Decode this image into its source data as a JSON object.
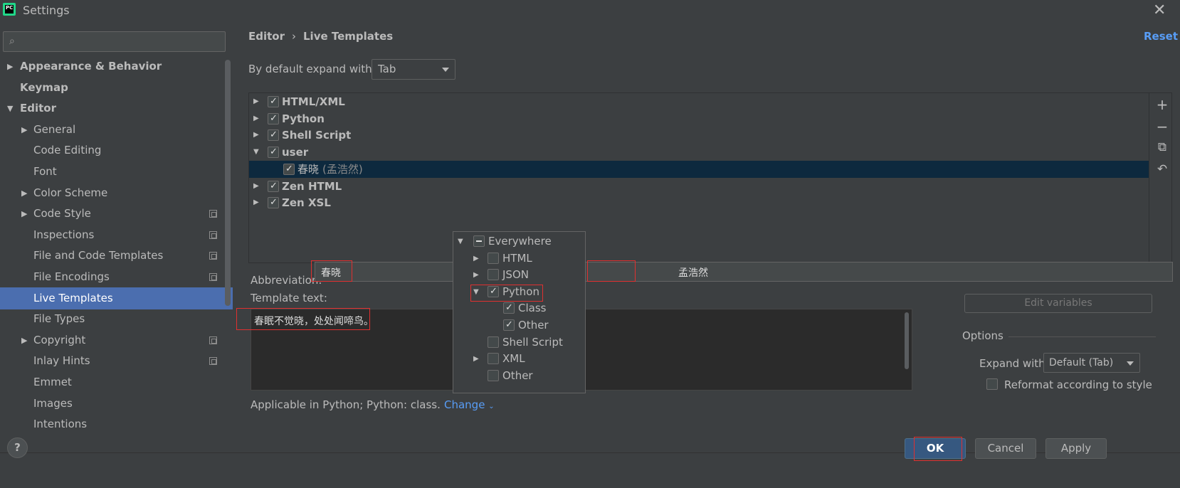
{
  "window": {
    "title": "Settings",
    "logo": "PC"
  },
  "sidebar": {
    "search": {
      "value": "",
      "placeholder": ""
    },
    "items": [
      {
        "label": "Appearance & Behavior",
        "bold": true,
        "arrow": "right",
        "indent": 0
      },
      {
        "label": "Keymap",
        "bold": true,
        "arrow": "",
        "indent": 0
      },
      {
        "label": "Editor",
        "bold": true,
        "arrow": "down",
        "indent": 0
      },
      {
        "label": "General",
        "bold": false,
        "arrow": "right",
        "indent": 1
      },
      {
        "label": "Code Editing",
        "bold": false,
        "arrow": "",
        "indent": 1
      },
      {
        "label": "Font",
        "bold": false,
        "arrow": "",
        "indent": 1
      },
      {
        "label": "Color Scheme",
        "bold": false,
        "arrow": "right",
        "indent": 1
      },
      {
        "label": "Code Style",
        "bold": false,
        "arrow": "right",
        "indent": 1,
        "copy": true
      },
      {
        "label": "Inspections",
        "bold": false,
        "arrow": "",
        "indent": 1,
        "copy": true
      },
      {
        "label": "File and Code Templates",
        "bold": false,
        "arrow": "",
        "indent": 1,
        "copy": true
      },
      {
        "label": "File Encodings",
        "bold": false,
        "arrow": "",
        "indent": 1,
        "copy": true
      },
      {
        "label": "Live Templates",
        "bold": false,
        "arrow": "",
        "indent": 1,
        "selected": true
      },
      {
        "label": "File Types",
        "bold": false,
        "arrow": "",
        "indent": 1
      },
      {
        "label": "Copyright",
        "bold": false,
        "arrow": "right",
        "indent": 1,
        "copy": true
      },
      {
        "label": "Inlay Hints",
        "bold": false,
        "arrow": "",
        "indent": 1,
        "copy": true
      },
      {
        "label": "Emmet",
        "bold": false,
        "arrow": "",
        "indent": 1
      },
      {
        "label": "Images",
        "bold": false,
        "arrow": "",
        "indent": 1
      },
      {
        "label": "Intentions",
        "bold": false,
        "arrow": "",
        "indent": 1
      }
    ]
  },
  "header": {
    "breadcrumb": [
      "Editor",
      "Live Templates"
    ],
    "reset": "Reset"
  },
  "expand": {
    "label": "By default expand with",
    "value": "Tab"
  },
  "tree": {
    "rows": [
      {
        "label": "HTML/XML",
        "checked": true,
        "arrow": "right",
        "level": 0
      },
      {
        "label": "Python",
        "checked": true,
        "arrow": "right",
        "level": 0
      },
      {
        "label": "Shell Script",
        "checked": true,
        "arrow": "right",
        "level": 0
      },
      {
        "label": "user",
        "checked": true,
        "arrow": "down",
        "level": 0
      },
      {
        "label": "春晓",
        "desc": "(孟浩然)",
        "checked": true,
        "arrow": "",
        "level": 1,
        "selected": true
      },
      {
        "label": "Zen HTML",
        "checked": true,
        "arrow": "right",
        "level": 0
      },
      {
        "label": "Zen XSL",
        "checked": true,
        "arrow": "right",
        "level": 0
      }
    ],
    "toolbar": {
      "add": "+",
      "remove": "−",
      "copy": "⧉",
      "restore": "↶"
    }
  },
  "abbreviation": {
    "label": "Abbreviation:",
    "value": "春晓",
    "description": "孟浩然"
  },
  "template_text": {
    "label": "Template text:",
    "value": "春眠不觉晓，处处闻啼鸟。"
  },
  "edit_variables": "Edit variables",
  "options": {
    "title": "Options",
    "expand_with_label": "Expand with",
    "expand_with_value": "Default (Tab)",
    "reformat_label": "Reformat according to style"
  },
  "applicable": {
    "text": "Applicable in Python; Python: class.",
    "change": "Change"
  },
  "popup": {
    "rows": [
      {
        "label": "Everywhere",
        "state": "dash",
        "arrow": "down",
        "level": 0
      },
      {
        "label": "HTML",
        "state": "off",
        "arrow": "right",
        "level": 1
      },
      {
        "label": "JSON",
        "state": "off",
        "arrow": "right",
        "level": 1
      },
      {
        "label": "Python",
        "state": "on",
        "arrow": "down",
        "level": 1
      },
      {
        "label": "Class",
        "state": "on",
        "arrow": "",
        "level": 2
      },
      {
        "label": "Other",
        "state": "on",
        "arrow": "",
        "level": 2
      },
      {
        "label": "Shell Script",
        "state": "off",
        "arrow": "",
        "level": 1
      },
      {
        "label": "XML",
        "state": "off",
        "arrow": "right",
        "level": 1
      },
      {
        "label": "Other",
        "state": "off",
        "arrow": "",
        "level": 1
      }
    ]
  },
  "footer": {
    "help": "?",
    "ok": "OK",
    "cancel": "Cancel",
    "apply": "Apply"
  }
}
